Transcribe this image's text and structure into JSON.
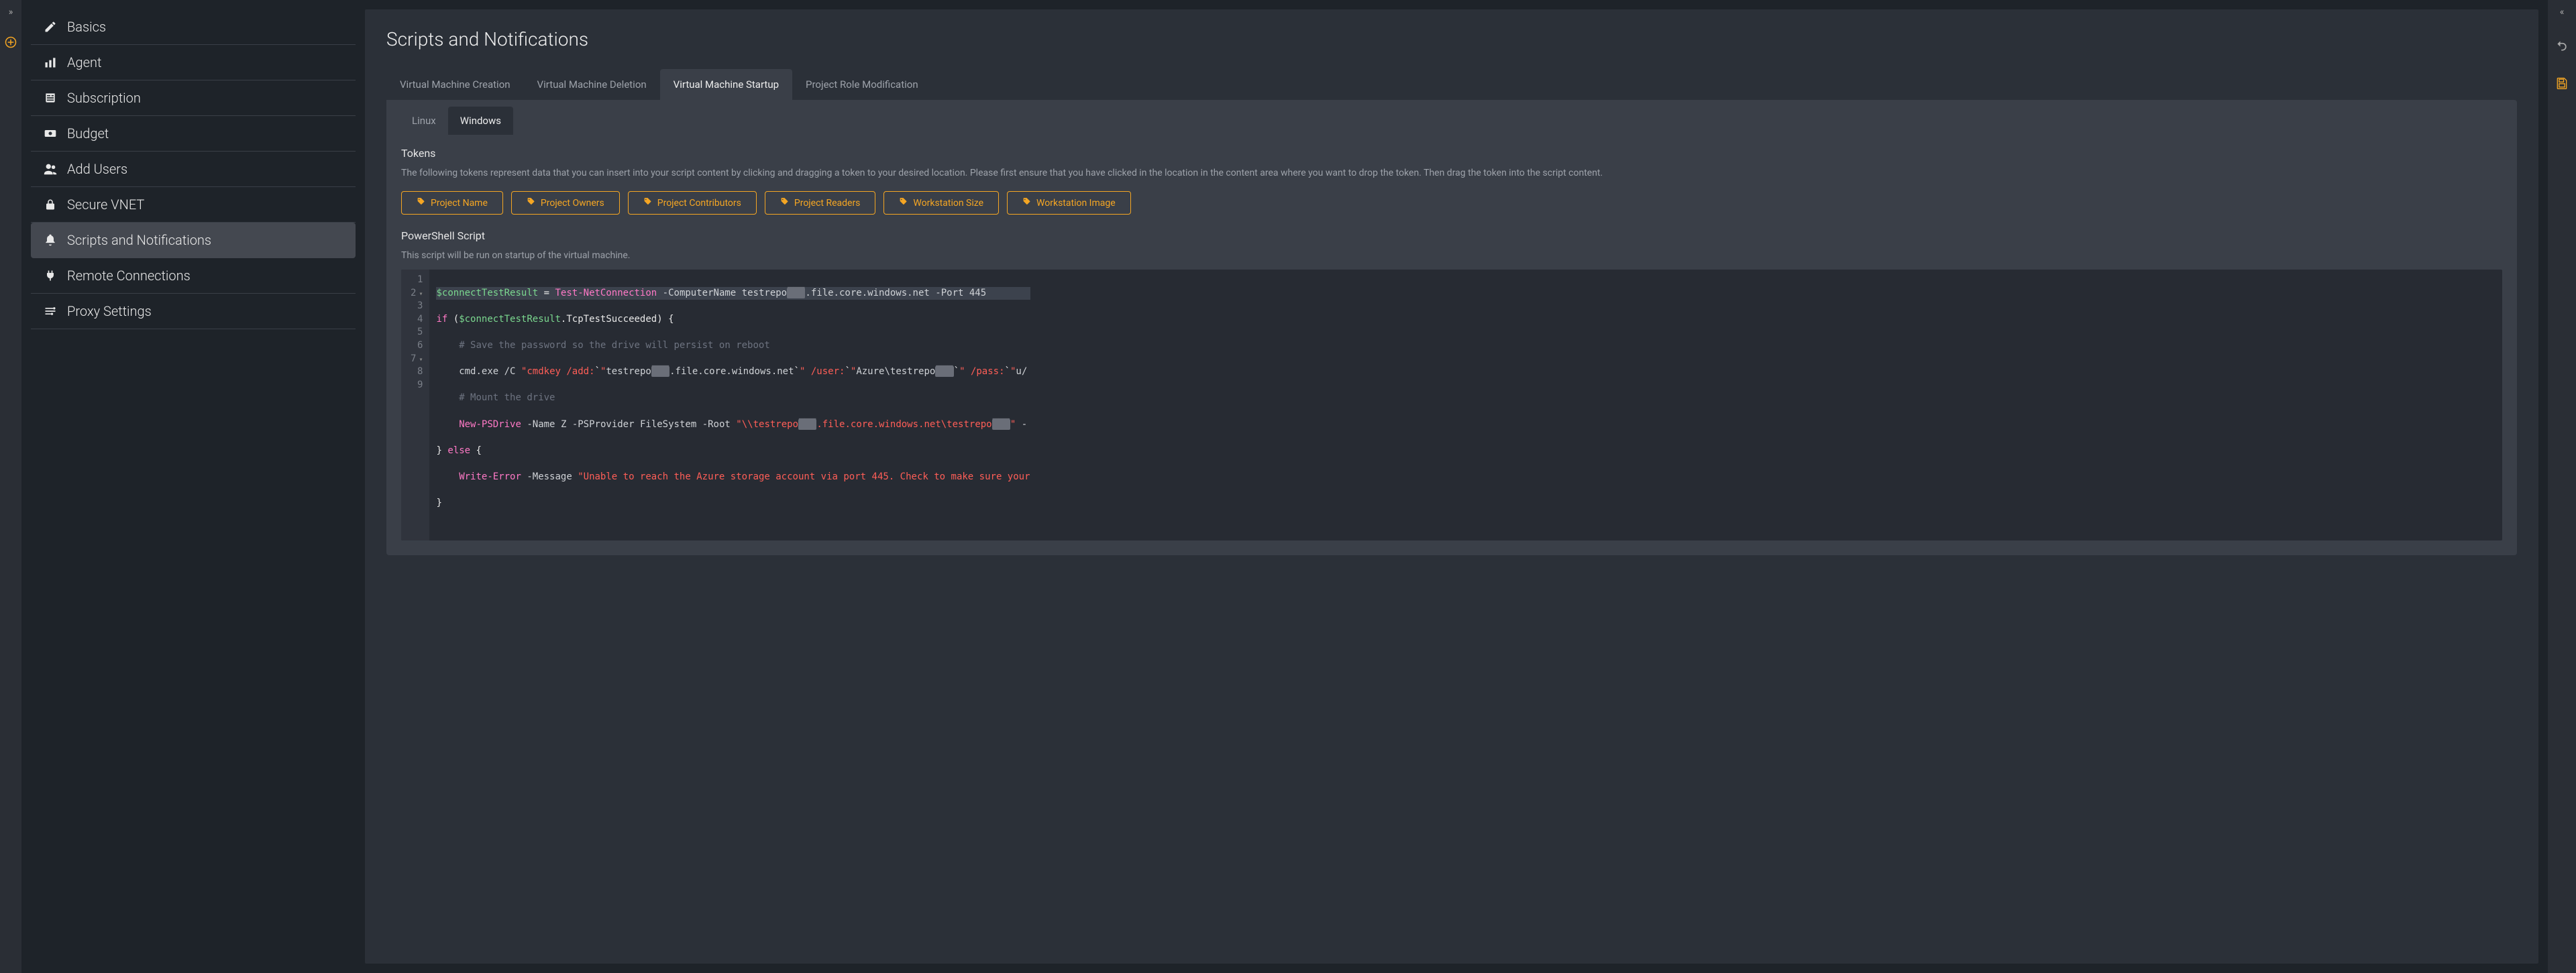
{
  "sidebar": {
    "items": [
      {
        "label": "Basics",
        "icon": "pencil"
      },
      {
        "label": "Agent",
        "icon": "bars"
      },
      {
        "label": "Subscription",
        "icon": "news"
      },
      {
        "label": "Budget",
        "icon": "cash"
      },
      {
        "label": "Add Users",
        "icon": "users"
      },
      {
        "label": "Secure VNET",
        "icon": "lock"
      },
      {
        "label": "Scripts and Notifications",
        "icon": "bell",
        "active": true
      },
      {
        "label": "Remote Connections",
        "icon": "plug"
      },
      {
        "label": "Proxy Settings",
        "icon": "sliders"
      }
    ]
  },
  "page": {
    "title": "Scripts and Notifications"
  },
  "tabs": [
    {
      "label": "Virtual Machine Creation"
    },
    {
      "label": "Virtual Machine Deletion"
    },
    {
      "label": "Virtual Machine Startup",
      "active": true
    },
    {
      "label": "Project Role Modification"
    }
  ],
  "os_tabs": [
    {
      "label": "Linux"
    },
    {
      "label": "Windows",
      "active": true
    }
  ],
  "tokens_section": {
    "heading": "Tokens",
    "description": "The following tokens represent data that you can insert into your script content by clicking and dragging a token to your desired location. Please first ensure that you have clicked in the location in the content area where you want to drop the token. Then drag the token into the script content."
  },
  "tokens": [
    "Project Name",
    "Project Owners",
    "Project Contributors",
    "Project Readers",
    "Workstation Size",
    "Workstation Image"
  ],
  "script_section": {
    "heading": "PowerShell Script",
    "description": "This script will be run on startup of the virtual machine."
  },
  "script_lines": [
    "$connectTestResult = Test-NetConnection -ComputerName testrepo███.file.core.windows.net -Port 445",
    "if ($connectTestResult.TcpTestSucceeded) {",
    "    # Save the password so the drive will persist on reboot",
    "    cmd.exe /C \"cmdkey /add:`\"testrepo███.file.core.windows.net`\" /user:`\"Azure\\testrepo███`\" /pass:`\"u/",
    "    # Mount the drive",
    "    New-PSDrive -Name Z -PSProvider FileSystem -Root \"\\\\testrepo███.file.core.windows.net\\testrepo███\" -",
    "} else {",
    "    Write-Error -Message \"Unable to reach the Azure storage account via port 445. Check to make sure your",
    "}"
  ],
  "left_rail": {
    "add_tooltip": "Add"
  },
  "right_rail": {
    "undo_tooltip": "Undo",
    "save_tooltip": "Save"
  }
}
